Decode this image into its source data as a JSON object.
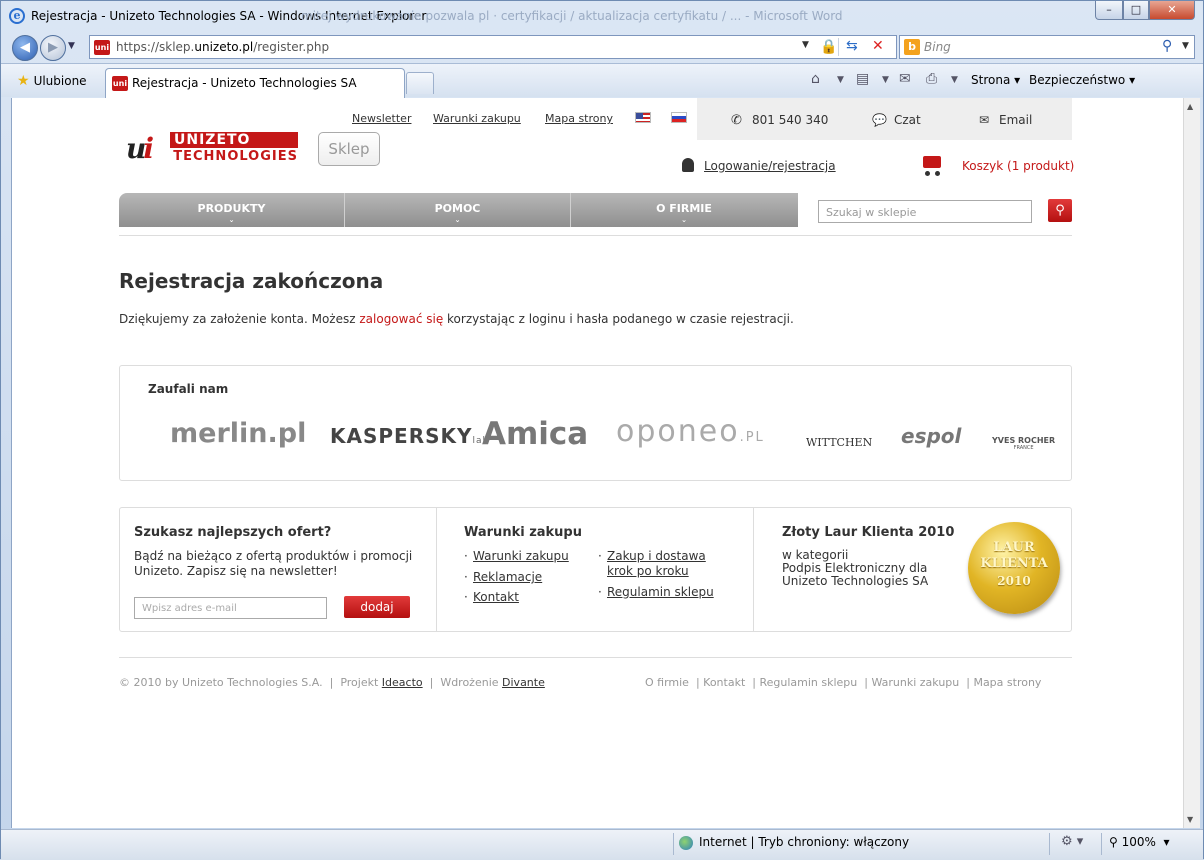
{
  "window": {
    "title": "Rejestracja - Unizeto Technologies SA - Windows Internet Explorer",
    "background_tabs": "mitej wydrukowanie pozwala pl · certyfikacji / aktualizacja certyfikatu / ... - Microsoft Word",
    "min_label": "–",
    "max_label": "□",
    "close_label": "✕"
  },
  "navbar": {
    "address_prefix": "https://sklep.",
    "address_domain": "unizeto.pl",
    "address_path": "/register.php",
    "search_placeholder": "Bing"
  },
  "favbar": {
    "favorites_label": "Ulubione",
    "tab_label": "Rejestracja - Unizeto Technologies SA",
    "page_menu": "Strona",
    "safety_menu": "Bezpieczeństwo"
  },
  "site": {
    "top_links": [
      "Newsletter",
      "Warunki zakupu",
      "Mapa strony"
    ],
    "phone": "801 540 340",
    "chat": "Czat",
    "email": "Email",
    "logo_top": "UNIZETO",
    "logo_bottom": "TECHNOLOGIES",
    "shop_button": "Sklep",
    "login_link": "Logowanie/rejestracja",
    "cart_link": "Koszyk (1 produkt)",
    "menu": [
      "PRODUKTY",
      "POMOC",
      "O FIRMIE"
    ],
    "search_placeholder": "Szukaj w sklepie"
  },
  "main": {
    "heading": "Rejestracja zakończona",
    "text_before": "Dziękujemy za założenie konta. Możesz ",
    "login_link": "zalogować się",
    "text_after": " korzystając z loginu i hasła podanego w czasie rejestracji."
  },
  "trusted": {
    "heading": "Zaufali nam",
    "brands": [
      "merlin.pl",
      "KASPERSKY",
      "lab",
      "Amica",
      "oponeo",
      ".PL",
      "WITTCHEN",
      "espol",
      "YVES ROCHER",
      "FRANCE"
    ]
  },
  "newsletter": {
    "heading": "Szukasz najlepszych ofert?",
    "text_line1": "Bądź na bieżąco z ofertą produktów i promocji",
    "text_line2": "Unizeto. Zapisz się na newsletter!",
    "input_placeholder": "Wpisz adres e-mail",
    "button": "dodaj"
  },
  "terms": {
    "heading": "Warunki zakupu",
    "links_left": [
      "Warunki zakupu",
      "Reklamacje",
      "Kontakt"
    ],
    "links_right_1a": "Zakup i dostawa",
    "links_right_1b": "krok po kroku",
    "links_right_2": "Regulamin sklepu"
  },
  "award": {
    "heading": "Złoty Laur Klienta 2010",
    "line1": "w kategorii",
    "line2": "Podpis Elektroniczny dla",
    "line3": "Unizeto Technologies SA",
    "badge_1": "LAUR",
    "badge_2": "KLIENTA",
    "badge_3": "2010"
  },
  "footer": {
    "copyright": "© 2010 by Unizeto Technologies S.A.",
    "project_label": "Projekt",
    "project_link": "Ideacto",
    "deploy_label": "Wdrożenie",
    "deploy_link": "Divante",
    "links": [
      "O firmie",
      "Kontakt",
      "Regulamin sklepu",
      "Warunki zakupu",
      "Mapa strony"
    ]
  },
  "statusbar": {
    "zone": "Internet | Tryb chroniony: włączony",
    "zoom": "100%"
  }
}
